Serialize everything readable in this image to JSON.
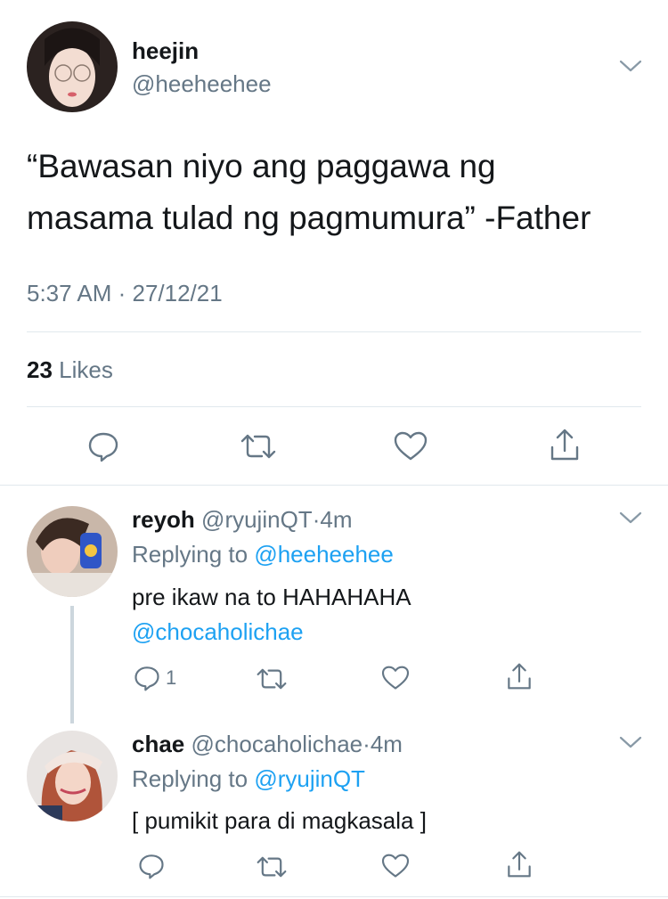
{
  "colors": {
    "accent": "#1da1f2",
    "secondary_text": "#657786",
    "divider": "#e1e8ed"
  },
  "tweet": {
    "display_name": "heejin",
    "handle": "@heeheehee",
    "text_line1": "“Bawasan niyo ang paggawa ng",
    "text_line2": "masama tulad ng pagmumura” -Father",
    "timestamp": "5:37 AM · 27/12/21",
    "likes_count": "23",
    "likes_label": "Likes",
    "actions": [
      "reply-icon",
      "retweet-icon",
      "like-icon",
      "share-icon"
    ]
  },
  "replies": [
    {
      "display_name": "reyoh",
      "handle": "@ryujinQT",
      "time": "4m",
      "replying_prefix": "Replying to",
      "replying_to": "@heeheehee",
      "text": "pre ikaw na to HAHAHAHA",
      "mention": "@chocaholichae",
      "reply_count": "1"
    },
    {
      "display_name": "chae",
      "handle": "@chocaholichae",
      "time": "4m",
      "replying_prefix": "Replying to",
      "replying_to": "@ryujinQT",
      "text": "[ pumikit para di magkasala ]"
    }
  ]
}
